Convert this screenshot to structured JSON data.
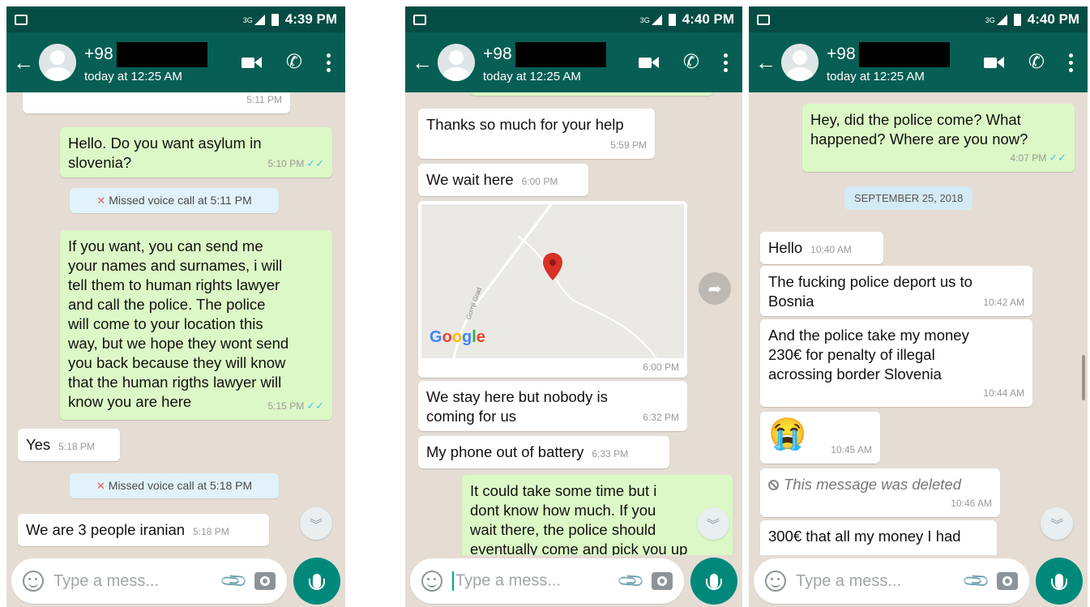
{
  "phones": [
    {
      "status": {
        "time": "4:39 PM",
        "network": "3G"
      },
      "header": {
        "name": "+98",
        "last_seen": "today at 12:25 AM"
      },
      "messages": [
        {
          "type": "in_partial",
          "time": "5:11 PM"
        },
        {
          "type": "out",
          "text": "Hello. Do you want asylum in\nslovenia?",
          "time": "5:10 PM"
        },
        {
          "type": "system",
          "text": "Missed voice call at 5:11 PM"
        },
        {
          "type": "out",
          "text": "If you want, you can send me\nyour names and surnames, i will\ntell them to human rights lawyer\nand call the police. The police\nwill come to your location this\nway, but we hope they wont send\nyou back because they will know\nthat the human rigths lawyer will\nknow you are here",
          "time": "5:15 PM"
        },
        {
          "type": "in",
          "text": "Yes",
          "time": "5:18 PM"
        },
        {
          "type": "system",
          "text": "Missed voice call at 5:18 PM"
        },
        {
          "type": "in",
          "text": "We are 3 people iranian",
          "time": "5:18 PM"
        }
      ],
      "input_placeholder": "Type a mess..."
    },
    {
      "status": {
        "time": "4:40 PM",
        "network": "3G"
      },
      "header": {
        "name": "+98",
        "last_seen": "today at 12:25 AM"
      },
      "messages": [
        {
          "type": "in",
          "text": "Thanks so much for your help",
          "time": "5:59 PM"
        },
        {
          "type": "in",
          "text": "We wait here",
          "time": "6:00 PM"
        },
        {
          "type": "location",
          "time": "6:00 PM",
          "map_label": "Google",
          "road_label": "Gornji Grad"
        },
        {
          "type": "in",
          "text": "We stay here but nobody is\ncoming for us",
          "time": "6:32 PM"
        },
        {
          "type": "in",
          "text": "My phone out of battery",
          "time": "6:33 PM"
        },
        {
          "type": "out",
          "text": "It could take some time but i\ndont know how much. If you\nwait there, the police should\neventually come and pick you up"
        }
      ],
      "input_placeholder": "Type a mess..."
    },
    {
      "status": {
        "time": "4:40 PM",
        "network": "3G"
      },
      "header": {
        "name": "+98",
        "last_seen": "today at 12:25 AM"
      },
      "messages": [
        {
          "type": "out",
          "text": "Hey, did the police come? What\nhappened? Where are you now?",
          "time": "4:07 PM"
        },
        {
          "type": "date",
          "text": "SEPTEMBER 25, 2018"
        },
        {
          "type": "in",
          "text": "Hello",
          "time": "10:40 AM"
        },
        {
          "type": "in",
          "text": "The fucking police deport us to\nBosnia",
          "time": "10:42 AM"
        },
        {
          "type": "in",
          "text": "And the police take my money\n230€ for penalty of illegal\nacrossing border Slovenia",
          "time": "10:44 AM"
        },
        {
          "type": "emoji",
          "emoji": "😭",
          "time": "10:45 AM"
        },
        {
          "type": "deleted",
          "text": "This message was deleted",
          "time": "10:46 AM"
        },
        {
          "type": "in",
          "text": "300€ that all my money I had"
        }
      ],
      "input_placeholder": "Type a mess..."
    }
  ]
}
